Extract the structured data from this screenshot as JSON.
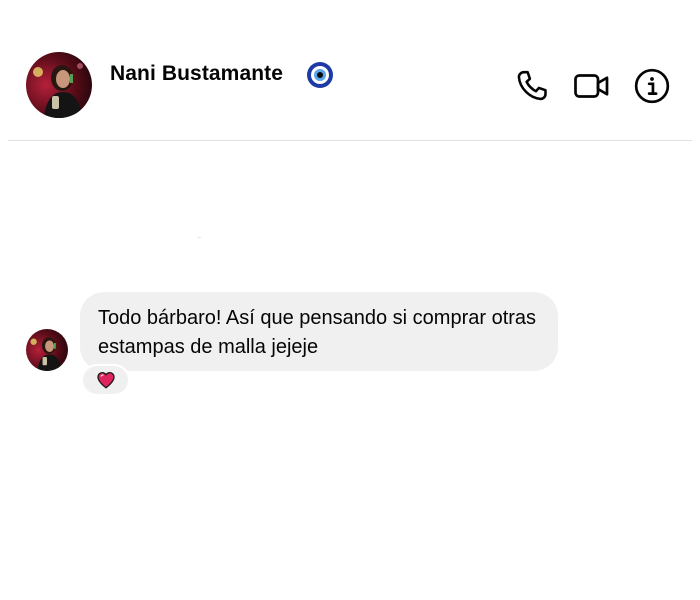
{
  "conversation": {
    "contact": {
      "name": "Nani Bustamante",
      "emoji": "nazar-amulet-icon"
    },
    "header_actions": [
      {
        "name": "call",
        "icon": "phone-icon"
      },
      {
        "name": "video-call",
        "icon": "video-camera-icon"
      },
      {
        "name": "info",
        "icon": "info-icon"
      }
    ],
    "messages": [
      {
        "sender": "Nani Bustamante",
        "text": "Todo bárbaro! Así que pensando si comprar otras estampas de malla jejeje",
        "reaction": "heart-icon"
      }
    ]
  },
  "colors": {
    "bubble_bg": "#f0f0f0",
    "text": "#050505",
    "divider": "#dddfe2",
    "reaction_heart": "#e0245e"
  }
}
